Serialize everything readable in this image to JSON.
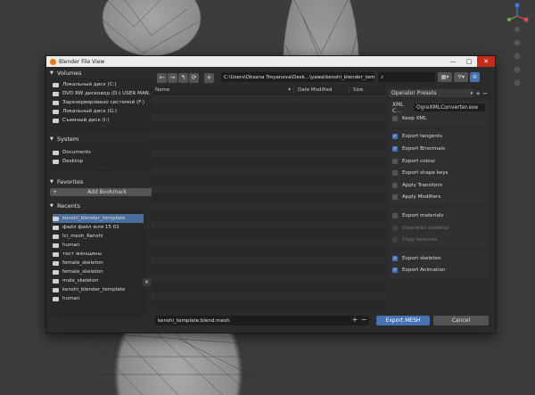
{
  "dialog": {
    "title": "Blender File View",
    "window_buttons": [
      "—",
      "□",
      "✕"
    ]
  },
  "volumes": {
    "header": "Volumes",
    "items": [
      "Локальный диск (C:)",
      "DVD RW дисковод (D:) USER MAN...",
      "Зарезервировано системой (F:)",
      "Локальный диск (G:)",
      "Съемный диск (I:)"
    ]
  },
  "system": {
    "header": "System",
    "items": [
      "Documents",
      "Desktop"
    ]
  },
  "favorites": {
    "header": "Favorites",
    "add_bookmark": "Add Bookmark"
  },
  "recents": {
    "header": "Recents",
    "items": [
      "kenshi_blender_template",
      "файл файл юля 15 01",
      "Ici_mesh_Kenshi",
      "human",
      "тест женщины",
      "female_skeleton",
      "female_skeleton",
      "male_skeleton",
      "kenshi_blender_template",
      "human"
    ],
    "selected_index": 0
  },
  "toolbar": {
    "path": "C:\\Users\\Oksana Troyanova\\Desk...\\yawa\\kenshi_blender_templat..."
  },
  "filelist": {
    "columns": [
      "Name",
      "Date Modified",
      "Size"
    ]
  },
  "footer": {
    "filename": "kenshi_template.blend.mesh",
    "export_label": "Export MESH",
    "cancel_label": "Cancel"
  },
  "operator": {
    "presets_label": "Operator Presets",
    "xml_label": "XML C...",
    "xml_value": "OgreXMLConverter.exe",
    "group1": [
      {
        "label": "Keep XML",
        "checked": false,
        "disabled": false
      }
    ],
    "group2": [
      {
        "label": "Export tangents",
        "checked": true,
        "disabled": false
      },
      {
        "label": "Export Binormals",
        "checked": true,
        "disabled": false
      },
      {
        "label": "Export colour",
        "checked": false,
        "disabled": false
      },
      {
        "label": "Export shape keys",
        "checked": false,
        "disabled": false
      },
      {
        "label": "Apply Transform",
        "checked": false,
        "disabled": false
      },
      {
        "label": "Apply Modifiers",
        "checked": false,
        "disabled": false
      }
    ],
    "group3": [
      {
        "label": "Export materials",
        "checked": false,
        "disabled": false
      },
      {
        "label": "Overwrite material",
        "checked": false,
        "disabled": true
      },
      {
        "label": "Copy textures",
        "checked": false,
        "disabled": true
      }
    ],
    "group4": [
      {
        "label": "Export skeleton",
        "checked": true,
        "disabled": false
      },
      {
        "label": "Export Animation",
        "checked": true,
        "disabled": false
      }
    ]
  },
  "colors": {
    "accent": "#4772b3",
    "selected_row": "#4b6e9c",
    "panel_bg": "#2b2b2b"
  }
}
